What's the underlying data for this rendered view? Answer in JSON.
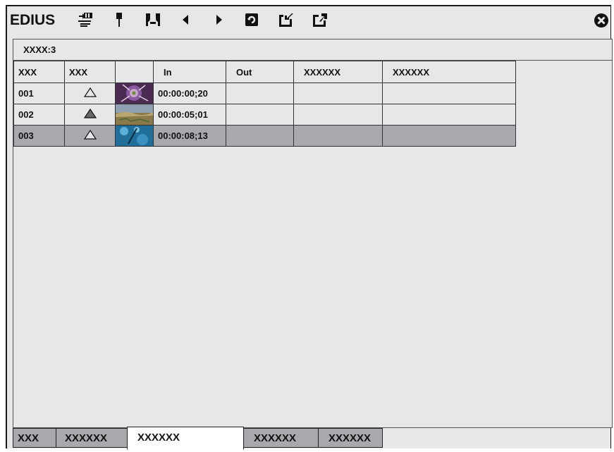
{
  "app": {
    "title": "EDIUS"
  },
  "toolbar": {
    "icons": [
      "import-clips-icon",
      "set-marker-icon",
      "link-markers-icon",
      "previous-marker-icon",
      "next-marker-icon",
      "delete-icon",
      "import-list-icon",
      "export-list-icon"
    ],
    "close_icon": "close-icon"
  },
  "clip_list": {
    "label": "XXXX:3",
    "columns": [
      "XXX",
      "XXX",
      "",
      "In",
      "Out",
      "XXXXXX",
      "XXXXXX"
    ],
    "rows": [
      {
        "no": "001",
        "status": "outline-triangle",
        "thumb": "purple-flower",
        "in": "00:00:00;20",
        "out": "",
        "c5": "",
        "c6": "",
        "selected": false
      },
      {
        "no": "002",
        "status": "filled-triangle",
        "thumb": "landscape",
        "in": "00:00:05;01",
        "out": "",
        "c5": "",
        "c6": "",
        "selected": false
      },
      {
        "no": "003",
        "status": "outline-triangle",
        "thumb": "blue-water",
        "in": "00:00:08;13",
        "out": "",
        "c5": "",
        "c6": "",
        "selected": true
      }
    ]
  },
  "tabs": [
    {
      "label": "XXX",
      "active": false
    },
    {
      "label": "XXXXXX",
      "active": false
    },
    {
      "label": "XXXXXX",
      "active": true
    },
    {
      "label": "XXXXXX",
      "active": false
    },
    {
      "label": "XXXXXX",
      "active": false
    }
  ],
  "colors": {
    "panel": "#e6e7e8",
    "selected_row": "#a7a9ac",
    "border": "#333333",
    "tab_inactive": "#a7a9ac"
  }
}
